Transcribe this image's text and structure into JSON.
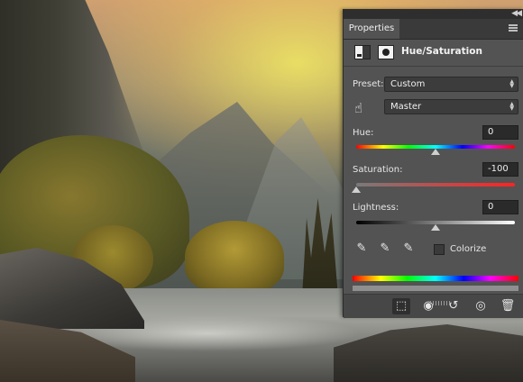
{
  "panel": {
    "tab_label": "Properties",
    "title": "Hue/Saturation",
    "preset_label": "Preset:",
    "preset_value": "Custom",
    "channel_value": "Master",
    "hue": {
      "label": "Hue:",
      "value": "0",
      "level": 0.5
    },
    "saturation": {
      "label": "Saturation:",
      "value": "-100",
      "level": 0.0
    },
    "lightness": {
      "label": "Lightness:",
      "value": "0",
      "level": 0.5
    },
    "colorize_label": "Colorize",
    "colorize_checked": false
  },
  "icons": {
    "collapse": "double-chevron-right-icon",
    "panel_menu": "panel-menu-icon",
    "adjustment": "adjustment-layer-icon",
    "mask": "layer-mask-icon",
    "targeted_adjustment": "hand-adjust-icon",
    "eyedroppers": [
      "eyedropper-icon",
      "eyedropper-plus-icon",
      "eyedropper-minus-icon"
    ],
    "footer": [
      "clip-to-layer-icon",
      "view-previous-icon",
      "reset-icon",
      "visibility-eye-icon",
      "trash-icon"
    ]
  }
}
